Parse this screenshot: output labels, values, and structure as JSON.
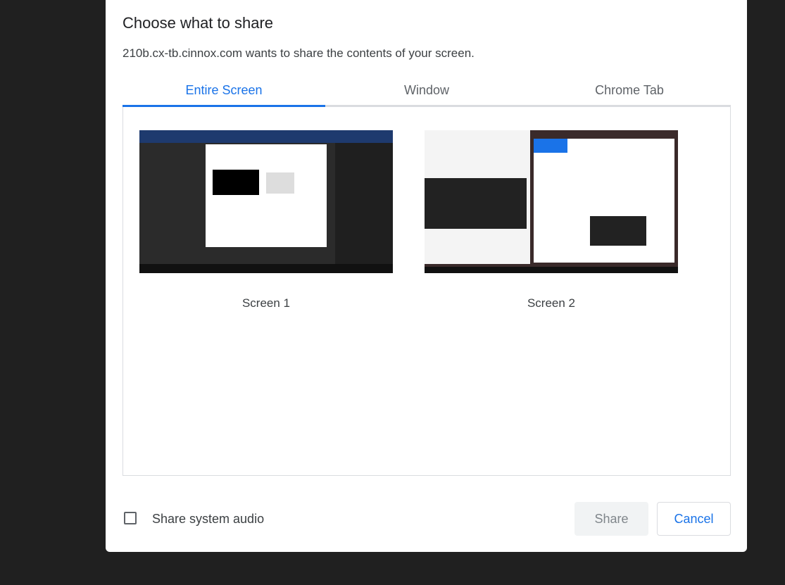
{
  "dialog": {
    "title": "Choose what to share",
    "subtitle": "210b.cx-tb.cinnox.com wants to share the contents of your screen.",
    "tabs": [
      {
        "label": "Entire Screen",
        "active": true
      },
      {
        "label": "Window",
        "active": false
      },
      {
        "label": "Chrome Tab",
        "active": false
      }
    ],
    "sources": [
      {
        "label": "Screen 1"
      },
      {
        "label": "Screen 2"
      }
    ],
    "audio_label": "Share system audio",
    "audio_checked": false,
    "share_label": "Share",
    "cancel_label": "Cancel",
    "accent": "#1a73e8"
  }
}
